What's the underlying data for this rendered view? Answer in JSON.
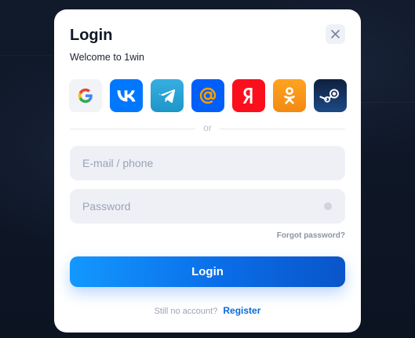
{
  "modal": {
    "title": "Login",
    "subtitle": "Welcome to 1win",
    "close_icon": "close-icon"
  },
  "social_logins": [
    {
      "name": "google",
      "icon": "google-icon",
      "bg": "#f1f3f7"
    },
    {
      "name": "vk",
      "icon": "vk-icon",
      "bg": "#0077ff"
    },
    {
      "name": "telegram",
      "icon": "telegram-icon",
      "bg": "#2ea3e0"
    },
    {
      "name": "mail",
      "icon": "at-sign-icon",
      "bg": "#005ff9"
    },
    {
      "name": "yandex",
      "icon": "yandex-icon",
      "bg": "#fc0f1d"
    },
    {
      "name": "odnoklassniki",
      "icon": "odnoklassniki-icon",
      "bg": "#f7931e"
    },
    {
      "name": "steam",
      "icon": "steam-icon",
      "bg": "#122b51"
    }
  ],
  "divider_text": "or",
  "form": {
    "email_placeholder": "E-mail / phone",
    "email_value": "",
    "password_placeholder": "Password",
    "password_value": "",
    "forgot_label": "Forgot password?",
    "login_label": "Login"
  },
  "footer": {
    "prompt": "Still no account?",
    "register_label": "Register"
  },
  "colors": {
    "accent": "#0a6de8",
    "register_link": "#0b6bd6",
    "background": "#0f1726"
  }
}
